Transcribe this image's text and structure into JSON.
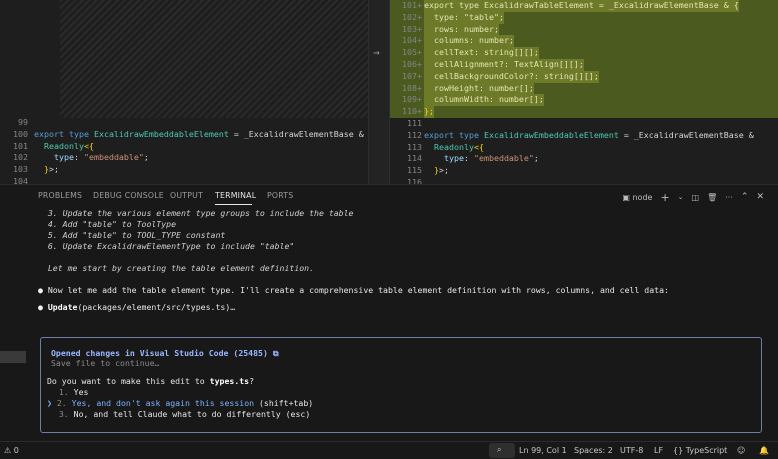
{
  "editor": {
    "left": {
      "lines": [
        {
          "n": "99",
          "segs": []
        },
        {
          "n": "100",
          "segs": [
            [
              "kw",
              "export type "
            ],
            [
              "ty",
              "ExcalidrawEmbeddableElement"
            ],
            [
              "pu",
              " = _ExcalidrawElementBase &"
            ]
          ]
        },
        {
          "n": "101",
          "segs": [
            [
              "pu",
              "  "
            ],
            [
              "ty",
              "Readonly"
            ],
            [
              "yel",
              "<{"
            ]
          ]
        },
        {
          "n": "102",
          "segs": [
            [
              "pr",
              "    type"
            ],
            [
              "pu",
              ": "
            ],
            [
              "str",
              "\"embeddable\""
            ],
            [
              "pu",
              ";"
            ]
          ]
        },
        {
          "n": "103",
          "segs": [
            [
              "yel",
              "  }"
            ],
            [
              "pu",
              ">;"
            ]
          ]
        },
        {
          "n": "104",
          "segs": []
        }
      ]
    },
    "right": {
      "lines": [
        {
          "n": "101+",
          "added": true,
          "segs": [
            [
              "kw",
              "export type "
            ],
            [
              "ty",
              "ExcalidrawTableElement"
            ],
            [
              "pu",
              " = _ExcalidrawElementBase & {"
            ]
          ]
        },
        {
          "n": "102+",
          "added": true,
          "segs": [
            [
              "pr",
              "  type"
            ],
            [
              "pu",
              ": "
            ],
            [
              "str",
              "\"table\""
            ],
            [
              "pu",
              ";"
            ]
          ]
        },
        {
          "n": "103+",
          "added": true,
          "segs": [
            [
              "pr",
              "  rows"
            ],
            [
              "pu",
              ": "
            ],
            [
              "ty",
              "number"
            ],
            [
              "pu",
              ";"
            ]
          ]
        },
        {
          "n": "104+",
          "added": true,
          "segs": [
            [
              "pr",
              "  columns"
            ],
            [
              "pu",
              ": "
            ],
            [
              "ty",
              "number"
            ],
            [
              "pu",
              ";"
            ]
          ]
        },
        {
          "n": "105+",
          "added": true,
          "segs": [
            [
              "pr",
              "  cellText"
            ],
            [
              "pu",
              ": "
            ],
            [
              "ty",
              "string[][]"
            ],
            [
              "pu",
              ";"
            ]
          ]
        },
        {
          "n": "106+",
          "added": true,
          "segs": [
            [
              "pr",
              "  cellAlignment?"
            ],
            [
              "pu",
              ": "
            ],
            [
              "ty",
              "TextAlign[][]"
            ],
            [
              "pu",
              ";"
            ]
          ]
        },
        {
          "n": "107+",
          "added": true,
          "segs": [
            [
              "pr",
              "  cellBackgroundColor?"
            ],
            [
              "pu",
              ": "
            ],
            [
              "ty",
              "string[][]"
            ],
            [
              "pu",
              ";"
            ]
          ]
        },
        {
          "n": "108+",
          "added": true,
          "segs": [
            [
              "pr",
              "  rowHeight"
            ],
            [
              "pu",
              ": "
            ],
            [
              "ty",
              "number[]"
            ],
            [
              "pu",
              ";"
            ]
          ]
        },
        {
          "n": "109+",
          "added": true,
          "segs": [
            [
              "pr",
              "  columnWidth"
            ],
            [
              "pu",
              ": "
            ],
            [
              "ty",
              "number[]"
            ],
            [
              "pu",
              ";"
            ]
          ]
        },
        {
          "n": "110+",
          "added": true,
          "segs": [
            [
              "yel",
              "};"
            ]
          ]
        },
        {
          "n": "111",
          "segs": []
        },
        {
          "n": "112",
          "segs": [
            [
              "kw",
              "export type "
            ],
            [
              "ty",
              "ExcalidrawEmbeddableElement"
            ],
            [
              "pu",
              " = _ExcalidrawElementBase &"
            ]
          ]
        },
        {
          "n": "113",
          "segs": [
            [
              "pu",
              "  "
            ],
            [
              "ty",
              "Readonly"
            ],
            [
              "yel",
              "<{"
            ]
          ]
        },
        {
          "n": "114",
          "segs": [
            [
              "pr",
              "    type"
            ],
            [
              "pu",
              ": "
            ],
            [
              "str",
              "\"embeddable\""
            ],
            [
              "pu",
              ";"
            ]
          ]
        },
        {
          "n": "115",
          "segs": [
            [
              "yel",
              "  }"
            ],
            [
              "pu",
              ">;"
            ]
          ]
        },
        {
          "n": "116",
          "segs": []
        }
      ]
    }
  },
  "panel": {
    "tabs": {
      "problems": "PROBLEMS",
      "debug_console": "DEBUG CONSOLE",
      "output": "OUTPUT",
      "terminal": "TERMINAL",
      "ports": "PORTS"
    },
    "actions": {
      "shell": "node",
      "new_terminal_icon": "plus-icon",
      "split_icon": "split-icon",
      "trash_icon": "trash-icon",
      "more_icon": "ellipsis-icon",
      "maximize_icon": "chevron-up-icon",
      "close_icon": "close-icon"
    }
  },
  "terminal": {
    "steps": [
      "  3. Update the various element type groups to include the table",
      "  4. Add \"table\" to ToolType",
      "  5. Add \"table\" to TOOL_TYPE constant",
      "  6. Update ExcalidrawElementType to include \"table\""
    ],
    "lead": "  Let me start by creating the table element definition.",
    "message": "Now let me add the table element type. I'll create a comprehensive table element definition with rows, columns, and cell data:",
    "update_cmd": "Update",
    "update_args": "(packages/element/src/types.ts)…",
    "dialog": {
      "title": "Opened changes in Visual Studio Code (25485) ⧉",
      "subtitle": "Save file to continue…",
      "question_prefix": "Do you want to make this edit to ",
      "question_file": "types.ts",
      "question_suffix": "?",
      "options": [
        {
          "num": "1.",
          "label": "Yes",
          "hint": ""
        },
        {
          "num": "2.",
          "label": "Yes, and don't ask again this session",
          "hint": " (shift+tab)"
        },
        {
          "num": "3.",
          "label": "No, and tell Claude what to do differently",
          "hint": " (esc)"
        }
      ],
      "selected_marker": "❯"
    }
  },
  "status": {
    "errors": "⚠ 0",
    "position": "Ln 99, Col 1",
    "spaces": "Spaces: 2",
    "encoding": "UTF-8",
    "eol": "LF",
    "language": "TypeScript"
  }
}
